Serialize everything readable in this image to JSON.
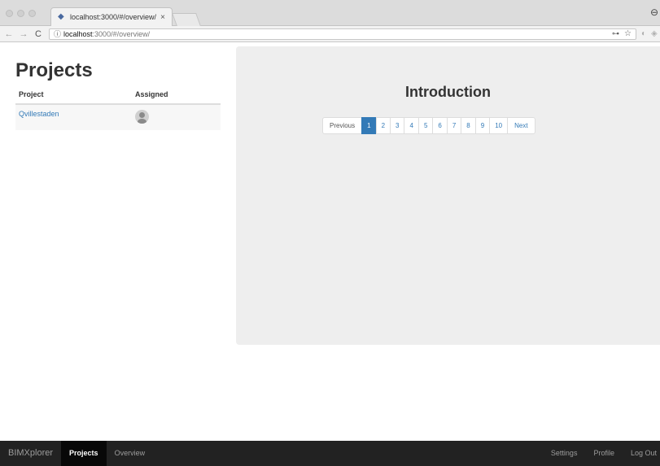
{
  "browser": {
    "tab_title": "localhost:3000/#/overview/",
    "tab_close": "×",
    "url_host": "localhost",
    "url_path": ":3000/#/overview/",
    "icons": {
      "back": "←",
      "forward": "→",
      "reload": "C",
      "info": "ⓘ",
      "key": "⊶",
      "star": "☆",
      "profile": "⊖"
    }
  },
  "sidebar": {
    "title": "Projects",
    "columns": [
      "Project",
      "Assigned"
    ],
    "rows": [
      {
        "project": "Qvillestaden"
      }
    ]
  },
  "main": {
    "title": "Introduction",
    "pagination": {
      "previous": "Previous",
      "pages": [
        "1",
        "2",
        "3",
        "4",
        "5",
        "6",
        "7",
        "8",
        "9",
        "10"
      ],
      "active_page": "1",
      "next": "Next"
    }
  },
  "navbar": {
    "brand": "BIMXplorer",
    "left_items": [
      "Projects",
      "Overview"
    ],
    "active_item": "Projects",
    "right_items": [
      "Settings",
      "Profile",
      "Log Out"
    ]
  },
  "colors": {
    "accent": "#337ab7",
    "navbar_bg": "#222222",
    "panel_bg": "#eeeeee"
  }
}
